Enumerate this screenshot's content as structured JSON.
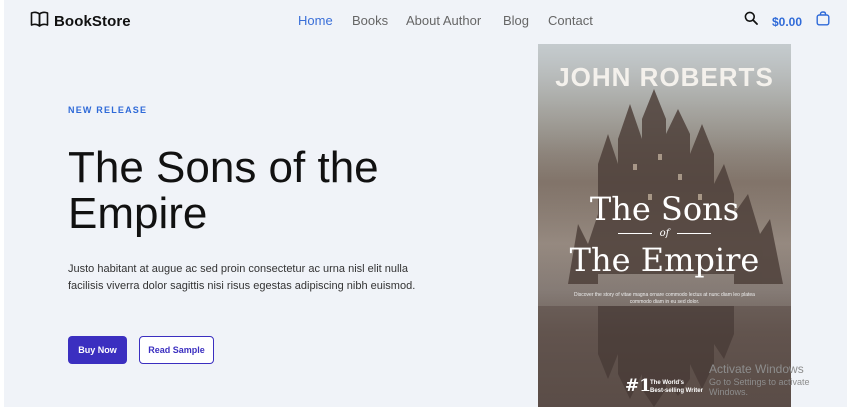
{
  "brand": {
    "name": "BookStore",
    "icon": "open-book-icon"
  },
  "nav": {
    "items": [
      {
        "label": "Home",
        "active": true
      },
      {
        "label": "Books",
        "active": false
      },
      {
        "label": "About Author",
        "active": false
      },
      {
        "label": "Blog",
        "active": false
      },
      {
        "label": "Contact",
        "active": false
      }
    ]
  },
  "header": {
    "search_icon": "search-icon",
    "cart_total": "$0.00",
    "cart_icon": "shopping-bag-icon"
  },
  "hero": {
    "eyebrow": "NEW RELEASE",
    "title": "The Sons of the Empire",
    "description": "Justo habitant at augue ac sed proin consectetur ac urna nisl elit nulla facilisis viverra dolor sagittis nisi risus egestas adipiscing nibh euismod.",
    "primary_button": "Buy Now",
    "secondary_button": "Read Sample"
  },
  "cover": {
    "author": "JOHN ROBERTS",
    "title_line1": "The Sons",
    "title_of": "of",
    "title_line2": "The Empire",
    "blurb": "Discover the story of vitae magna ornare commodo lectus at nunc diam leo platea commodo diam in eu sed dolor.",
    "rank": "#1",
    "rank_text_line1": "The World's",
    "rank_text_line2": "Best-selling Writer"
  },
  "os_watermark": {
    "line1": "Activate Windows",
    "line2": "Go to Settings to activate Windows."
  },
  "colors": {
    "accent": "#2f6ad8",
    "button": "#3b2fc0",
    "background": "#f0f3f8"
  }
}
